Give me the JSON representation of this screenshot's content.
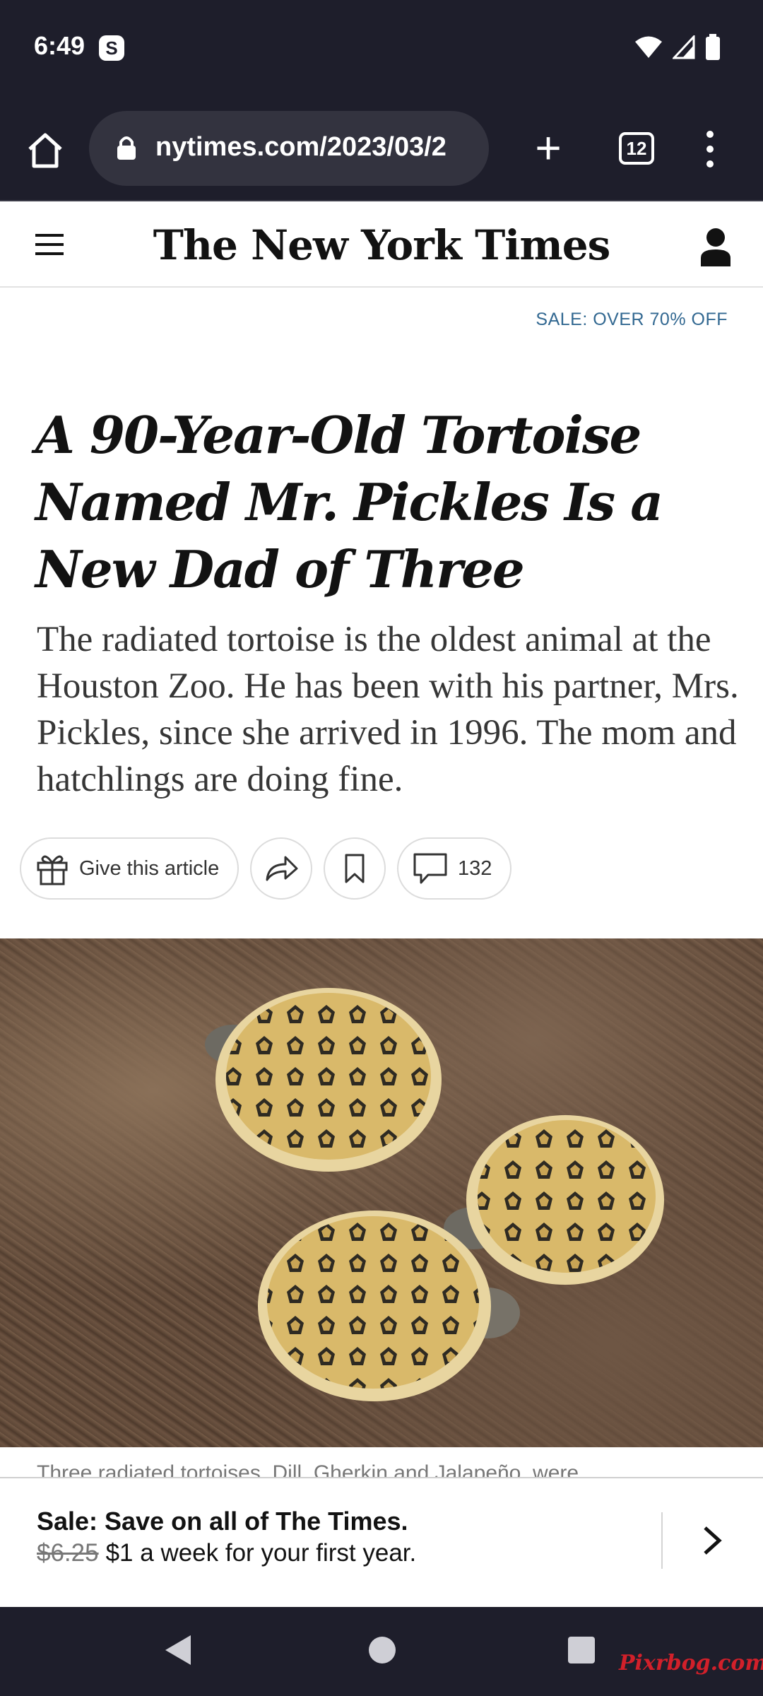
{
  "status_bar": {
    "time": "6:49",
    "app_badge": "S"
  },
  "browser": {
    "url": "nytimes.com/2023/03/2",
    "tab_count": "12",
    "icons": [
      "home-icon",
      "lock-icon",
      "new-tab-icon",
      "tab-switcher-icon",
      "overflow-menu-icon"
    ]
  },
  "header": {
    "masthead": "The New York Times"
  },
  "promo": {
    "sale_link": "SALE: OVER 70% OFF"
  },
  "article": {
    "headline": "A 90-Year-Old Tortoise Named Mr. Pickles Is a New Dad of Three",
    "summary": "The radiated tortoise is the oldest animal at the Houston Zoo. He has been with his partner, Mrs. Pickles, since she arrived in 1996. The mom and hatchlings are doing fine.",
    "actions": {
      "give_label": "Give this article",
      "comment_count": "132"
    },
    "caption_peek": "Three radiated tortoises, Dill, Gherkin and Jalapeño, were"
  },
  "sale_banner": {
    "title": "Sale: Save on all of The Times.",
    "old_price": "$6.25",
    "offer": "$1 a week for your first year."
  },
  "watermark": "Pixrbog.com",
  "colors": {
    "chrome_bg": "#1e1e2b",
    "link_blue": "#326891",
    "text": "#121212"
  }
}
